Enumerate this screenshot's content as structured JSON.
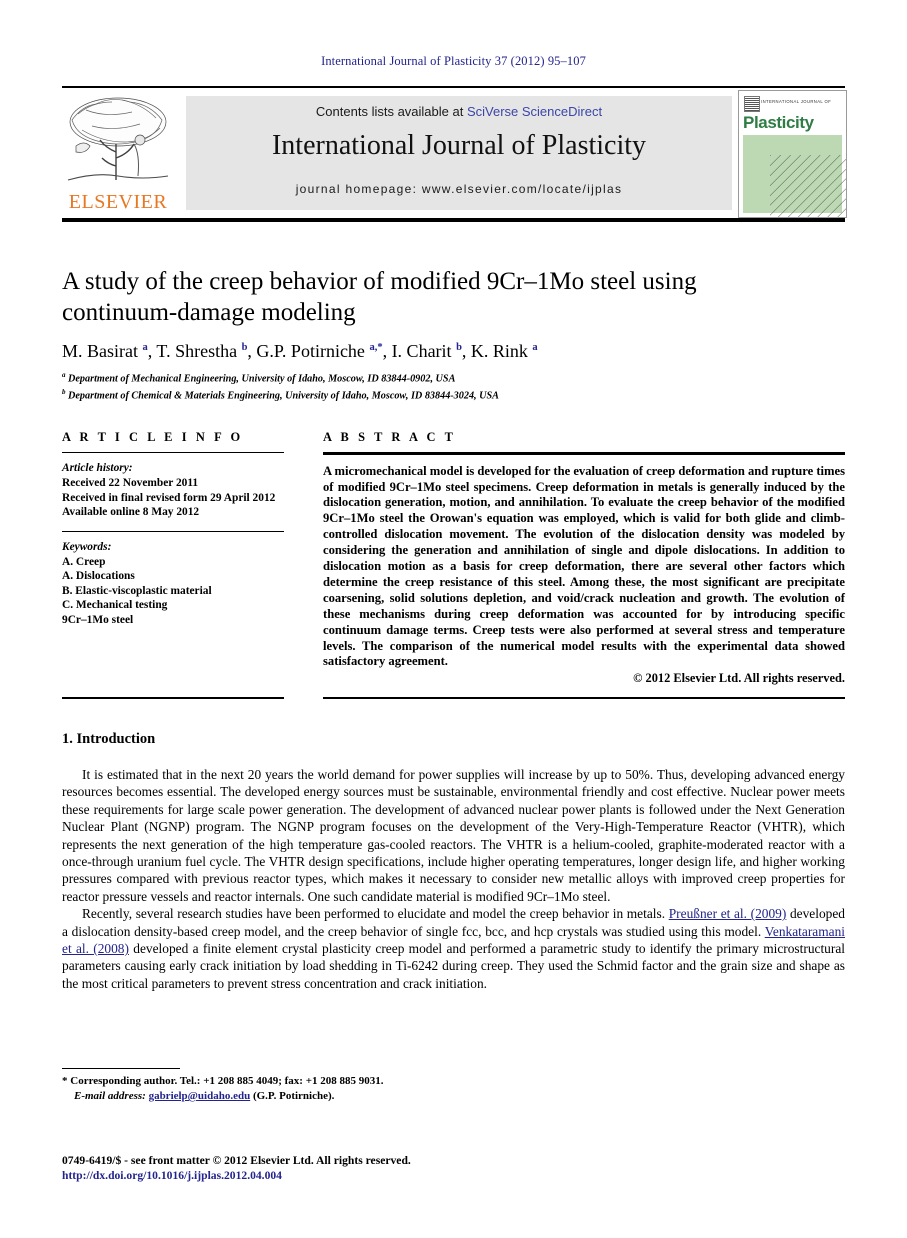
{
  "running_head": "International Journal of Plasticity 37 (2012) 95–107",
  "masthead": {
    "contents_prefix": "Contents lists available at ",
    "sciencedirect": "SciVerse ScienceDirect",
    "journal_name": "International Journal of Plasticity",
    "homepage": "journal homepage: www.elsevier.com/locate/ijplas",
    "publisher_logo": "ELSEVIER",
    "cover": {
      "small_label": "INTERNATIONAL JOURNAL OF",
      "title": "Plasticity"
    },
    "accent_link_color": "#3b45a8",
    "box_color": "#e5e5e5",
    "elsevier_orange": "#E87722",
    "cover_green": "#2f7d45"
  },
  "article": {
    "title": "A study of the creep behavior of modified 9Cr–1Mo steel using continuum-damage modeling",
    "authors_html": "M. Basirat <sup>a</sup>, T. Shrestha <sup>b</sup>, G.P. Potirniche <sup>a,*</sup>, I. Charit <sup>b</sup>, K. Rink <sup>a</sup>",
    "affiliation_a": "Department of Mechanical Engineering, University of Idaho, Moscow, ID 83844-0902, USA",
    "affiliation_b": "Department of Chemical & Materials Engineering, University of Idaho, Moscow, ID 83844-3024, USA"
  },
  "article_info": {
    "heading": "A R T I C L E    I N F O",
    "history_label": "Article history:",
    "history": [
      "Received 22 November 2011",
      "Received in final revised form 29 April 2012",
      "Available online 8 May 2012"
    ],
    "keywords_label": "Keywords:",
    "keywords": [
      "A. Creep",
      "A. Dislocations",
      "B. Elastic-viscoplastic material",
      "C. Mechanical testing",
      "9Cr–1Mo steel"
    ]
  },
  "abstract": {
    "heading": "A B S T R A C T",
    "text": "A micromechanical model is developed for the evaluation of creep deformation and rupture times of modified 9Cr–1Mo steel specimens. Creep deformation in metals is generally induced by the dislocation generation, motion, and annihilation. To evaluate the creep behavior of the modified 9Cr–1Mo steel the Orowan's equation was employed, which is valid for both glide and climb-controlled dislocation movement. The evolution of the dislocation density was modeled by considering the generation and annihilation of single and dipole dislocations. In addition to dislocation motion as a basis for creep deformation, there are several other factors which determine the creep resistance of this steel. Among these, the most significant are precipitate coarsening, solid solutions depletion, and void/crack nucleation and growth. The evolution of these mechanisms during creep deformation was accounted for by introducing specific continuum damage terms. Creep tests were also performed at several stress and temperature levels. The comparison of the numerical model results with the experimental data showed satisfactory agreement.",
    "copyright": "© 2012 Elsevier Ltd. All rights reserved."
  },
  "introduction": {
    "heading": "1. Introduction",
    "paragraph1": "It is estimated that in the next 20 years the world demand for power supplies will increase by up to 50%. Thus, developing advanced energy resources becomes essential. The developed energy sources must be sustainable, environmental friendly and cost effective. Nuclear power meets these requirements for large scale power generation. The development of advanced nuclear power plants is followed under the Next Generation Nuclear Plant (NGNP) program. The NGNP program focuses on the development of the Very-High-Temperature Reactor (VHTR), which represents the next generation of the high temperature gas-cooled reactors. The VHTR is a helium-cooled, graphite-moderated reactor with a once-through uranium fuel cycle. The VHTR design specifications, include higher operating temperatures, longer design life, and higher working pressures compared with previous reactor types, which makes it necessary to consider new metallic alloys with improved creep properties for reactor pressure vessels and reactor internals. One such candidate material is modified 9Cr–1Mo steel.",
    "paragraph2_part1": "Recently, several research studies have been performed to elucidate and model the creep behavior in metals. ",
    "citation1": "Preußner et al. (2009)",
    "paragraph2_part2": " developed a dislocation density-based creep model, and the creep behavior of single fcc, bcc, and hcp crystals was studied using this model. ",
    "citation2": "Venkataramani et al. (2008)",
    "paragraph2_part3": " developed a finite element crystal plasticity creep model and performed a parametric study to identify the primary microstructural parameters causing early crack initiation by load shedding in Ti-6242 during creep. They used the Schmid factor and the grain size and shape as the most critical parameters to prevent stress concentration and crack initiation."
  },
  "footer": {
    "corresponding_marker": "*",
    "corresponding": "Corresponding author. Tel.: +1 208 885 4049; fax: +1 208 885 9031.",
    "email_label": "E-mail address:",
    "email": "gabrielp@uidaho.edu",
    "email_suffix": "(G.P. Potirniche).",
    "issn_line": "0749-6419/$ - see front matter © 2012 Elsevier Ltd. All rights reserved.",
    "doi": "http://dx.doi.org/10.1016/j.ijplas.2012.04.004"
  }
}
